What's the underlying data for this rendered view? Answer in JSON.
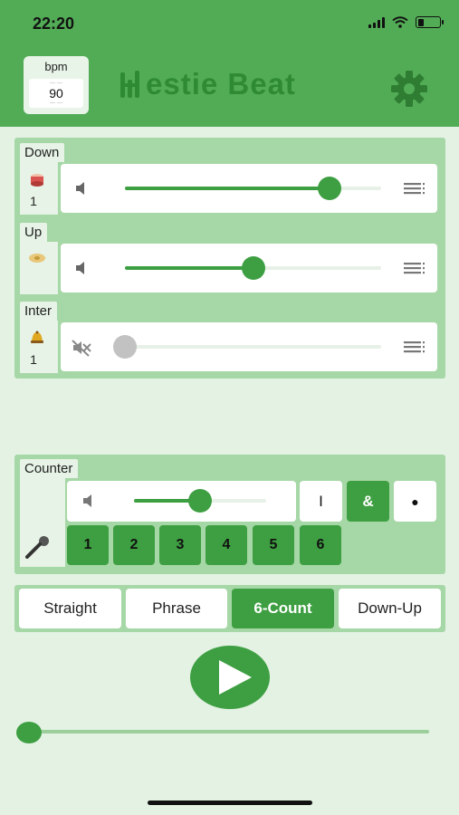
{
  "status": {
    "time": "22:20"
  },
  "header": {
    "bpm_label": "bpm",
    "bpm_value": "90",
    "title": "estie Beat"
  },
  "tracks": [
    {
      "label": "Down",
      "icon": "drum-icon",
      "count": "1",
      "volume": 0.8
    },
    {
      "label": "Up",
      "icon": "cymbal-icon",
      "count": "",
      "volume": 0.5
    },
    {
      "label": "Inter",
      "icon": "bell-icon",
      "count": "1",
      "volume": 0.0,
      "muted": true
    }
  ],
  "counter": {
    "label": "Counter",
    "volume": 0.5,
    "markers": [
      {
        "label": "I",
        "active": false
      },
      {
        "label": "&",
        "active": true
      },
      {
        "label": "●",
        "active": false
      }
    ],
    "beats": [
      "1",
      "2",
      "3",
      "4",
      "5",
      "6"
    ],
    "mic_icon": "microphone-icon"
  },
  "modes": [
    {
      "label": "Straight",
      "active": false
    },
    {
      "label": "Phrase",
      "active": false
    },
    {
      "label": "6-Count",
      "active": true
    },
    {
      "label": "Down-Up",
      "active": false
    }
  ],
  "playback": {
    "progress": 0.0
  },
  "colors": {
    "header": "#52ac56",
    "accent": "#3e9f42",
    "panel": "#a6d7a6",
    "background": "#e3f2e3"
  }
}
